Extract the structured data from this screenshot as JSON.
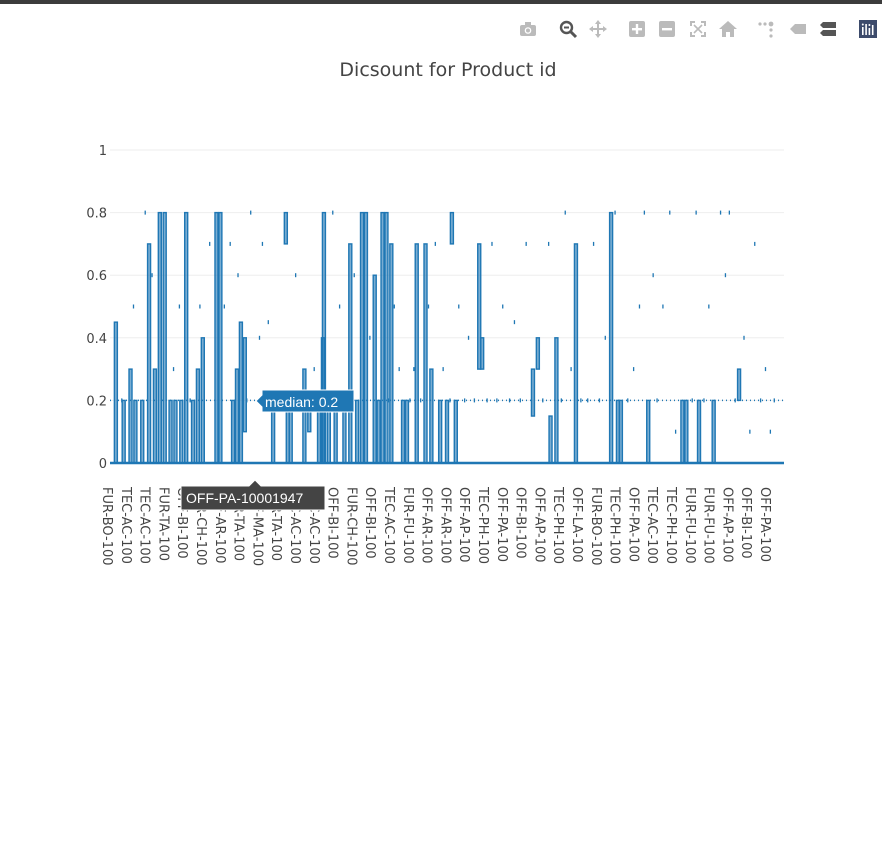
{
  "modebar": {
    "buttons": [
      {
        "name": "camera-icon",
        "title": "Download plot as a png"
      },
      {
        "name": "zoom-icon",
        "title": "Zoom"
      },
      {
        "name": "pan-icon",
        "title": "Pan"
      },
      {
        "name": "zoom-in-icon",
        "title": "Zoom in"
      },
      {
        "name": "zoom-out-icon",
        "title": "Zoom out"
      },
      {
        "name": "autoscale-icon",
        "title": "Autoscale"
      },
      {
        "name": "reset-axes-icon",
        "title": "Reset axes"
      },
      {
        "name": "spike-lines-icon",
        "title": "Toggle Spike Lines"
      },
      {
        "name": "hover-closest-icon",
        "title": "Show closest data on hover"
      },
      {
        "name": "hover-compare-icon",
        "title": "Compare data on hover"
      },
      {
        "name": "plotly-logo-icon",
        "title": "Produced with Plotly"
      }
    ]
  },
  "chart_data": {
    "type": "box",
    "title": "Dicsount for Product id",
    "xlabel": "",
    "ylabel": "",
    "ylim": [
      0,
      1
    ],
    "yticks": [
      0,
      0.2,
      0.4,
      0.6,
      0.8,
      1
    ],
    "ytick_labels": [
      "0",
      "0.2",
      "0.4",
      "0.6",
      "0.8",
      "1"
    ],
    "xtick_labels": [
      "FUR-BO-100",
      "TEC-AC-100",
      "TEC-AC-100",
      "FUR-TA-100",
      "OFF-BI-100",
      "FUR-CH-100",
      "OFF-AR-100",
      "FUR-TA-100",
      "OFF-MA-100",
      "FUR-TA-100",
      "TEC-AC-100",
      "TEC-AC-100",
      "OFF-BI-100",
      "FUR-CH-100",
      "OFF-BI-100",
      "TEC-AC-100",
      "FUR-FU-100",
      "OFF-AR-100",
      "OFF-AR-100",
      "OFF-AP-100",
      "TEC-PH-100",
      "OFF-PA-100",
      "OFF-BI-100",
      "OFF-AP-100",
      "TEC-PH-100",
      "OFF-LA-100",
      "FUR-BO-100",
      "TEC-PH-100",
      "OFF-PA-100",
      "TEC-AC-100",
      "TEC-PH-100",
      "FUR-FU-100",
      "FUR-FU-100",
      "OFF-AP-100",
      "OFF-BI-100",
      "OFF-PA-100"
    ],
    "series_color": "#1f77b4",
    "grid": true,
    "boxes": [
      {
        "x": 0.6,
        "lo": 0,
        "hi": 0.45
      },
      {
        "x": 1.4,
        "lo": 0,
        "hi": 0.2
      },
      {
        "x": 2.1,
        "lo": 0,
        "hi": 0.3
      },
      {
        "x": 2.6,
        "lo": 0,
        "hi": 0.2
      },
      {
        "x": 3.3,
        "lo": 0,
        "hi": 0.2
      },
      {
        "x": 4.0,
        "lo": 0,
        "hi": 0.7
      },
      {
        "x": 4.6,
        "lo": 0,
        "hi": 0.3
      },
      {
        "x": 5.1,
        "lo": 0,
        "hi": 0.8
      },
      {
        "x": 5.6,
        "lo": 0,
        "hi": 0.8
      },
      {
        "x": 6.2,
        "lo": 0,
        "hi": 0.2
      },
      {
        "x": 6.7,
        "lo": 0,
        "hi": 0.2
      },
      {
        "x": 7.3,
        "lo": 0,
        "hi": 0.2
      },
      {
        "x": 7.8,
        "lo": 0,
        "hi": 0.8
      },
      {
        "x": 8.5,
        "lo": 0,
        "hi": 0.2
      },
      {
        "x": 9.0,
        "lo": 0,
        "hi": 0.3
      },
      {
        "x": 9.5,
        "lo": 0,
        "hi": 0.4
      },
      {
        "x": 10.9,
        "lo": 0,
        "hi": 0.8
      },
      {
        "x": 11.3,
        "lo": 0,
        "hi": 0.8
      },
      {
        "x": 12.6,
        "lo": 0,
        "hi": 0.2
      },
      {
        "x": 13.0,
        "lo": 0,
        "hi": 0.3
      },
      {
        "x": 13.4,
        "lo": 0,
        "hi": 0.45
      },
      {
        "x": 13.8,
        "lo": 0.1,
        "hi": 0.4
      },
      {
        "x": 16.7,
        "lo": 0,
        "hi": 0.2
      },
      {
        "x": 18.0,
        "lo": 0.7,
        "hi": 0.8
      },
      {
        "x": 18.2,
        "lo": 0,
        "hi": 0.2
      },
      {
        "x": 18.5,
        "lo": 0,
        "hi": 0.2
      },
      {
        "x": 19.9,
        "lo": 0,
        "hi": 0.3
      },
      {
        "x": 20.4,
        "lo": 0.1,
        "hi": 0.2
      },
      {
        "x": 21.4,
        "lo": 0,
        "hi": 0.2
      },
      {
        "x": 21.8,
        "lo": 0,
        "hi": 0.4
      },
      {
        "x": 21.9,
        "lo": 0,
        "hi": 0.8
      },
      {
        "x": 22.4,
        "lo": 0,
        "hi": 0.2
      },
      {
        "x": 23.1,
        "lo": 0,
        "hi": 0.2
      },
      {
        "x": 24.0,
        "lo": 0,
        "hi": 0.2
      },
      {
        "x": 24.6,
        "lo": 0,
        "hi": 0.7
      },
      {
        "x": 25.3,
        "lo": 0,
        "hi": 0.2
      },
      {
        "x": 25.8,
        "lo": 0,
        "hi": 0.8
      },
      {
        "x": 26.2,
        "lo": 0,
        "hi": 0.8
      },
      {
        "x": 27.1,
        "lo": 0,
        "hi": 0.6
      },
      {
        "x": 27.5,
        "lo": 0,
        "hi": 0.2
      },
      {
        "x": 27.9,
        "lo": 0,
        "hi": 0.8
      },
      {
        "x": 28.3,
        "lo": 0,
        "hi": 0.8
      },
      {
        "x": 28.8,
        "lo": 0,
        "hi": 0.7
      },
      {
        "x": 30.0,
        "lo": 0,
        "hi": 0.2
      },
      {
        "x": 30.4,
        "lo": 0,
        "hi": 0.2
      },
      {
        "x": 31.4,
        "lo": 0,
        "hi": 0.7
      },
      {
        "x": 32.3,
        "lo": 0,
        "hi": 0.7
      },
      {
        "x": 32.9,
        "lo": 0,
        "hi": 0.3
      },
      {
        "x": 33.8,
        "lo": 0,
        "hi": 0.2
      },
      {
        "x": 34.5,
        "lo": 0,
        "hi": 0.2
      },
      {
        "x": 35.0,
        "lo": 0.7,
        "hi": 0.8
      },
      {
        "x": 35.4,
        "lo": 0,
        "hi": 0.2
      },
      {
        "x": 37.8,
        "lo": 0.3,
        "hi": 0.7
      },
      {
        "x": 38.1,
        "lo": 0.3,
        "hi": 0.4
      },
      {
        "x": 43.3,
        "lo": 0.15,
        "hi": 0.3
      },
      {
        "x": 43.8,
        "lo": 0.3,
        "hi": 0.4
      },
      {
        "x": 45.1,
        "lo": 0,
        "hi": 0.15
      },
      {
        "x": 45.7,
        "lo": 0,
        "hi": 0.4
      },
      {
        "x": 47.7,
        "lo": 0,
        "hi": 0.7
      },
      {
        "x": 51.3,
        "lo": 0,
        "hi": 0.8
      },
      {
        "x": 52.0,
        "lo": 0,
        "hi": 0.2
      },
      {
        "x": 52.3,
        "lo": 0,
        "hi": 0.2
      },
      {
        "x": 55.1,
        "lo": 0,
        "hi": 0.2
      },
      {
        "x": 58.6,
        "lo": 0,
        "hi": 0.2
      },
      {
        "x": 59.0,
        "lo": 0,
        "hi": 0.2
      },
      {
        "x": 60.3,
        "lo": 0,
        "hi": 0.2
      },
      {
        "x": 61.8,
        "lo": 0,
        "hi": 0.2
      },
      {
        "x": 64.4,
        "lo": 0.2,
        "hi": 0.3
      }
    ],
    "outliers": [
      {
        "x": 1.2,
        "y": 0.2
      },
      {
        "x": 2.4,
        "y": 0.5
      },
      {
        "x": 3.6,
        "y": 0.8
      },
      {
        "x": 4.3,
        "y": 0.6
      },
      {
        "x": 6.5,
        "y": 0.3
      },
      {
        "x": 7.1,
        "y": 0.5
      },
      {
        "x": 8.2,
        "y": 0.2
      },
      {
        "x": 9.2,
        "y": 0.5
      },
      {
        "x": 10.2,
        "y": 0.7
      },
      {
        "x": 11.7,
        "y": 0.5
      },
      {
        "x": 12.3,
        "y": 0.7
      },
      {
        "x": 13.1,
        "y": 0.6
      },
      {
        "x": 14.0,
        "y": 0.2
      },
      {
        "x": 14.4,
        "y": 0.8
      },
      {
        "x": 15.3,
        "y": 0.4
      },
      {
        "x": 15.6,
        "y": 0.7
      },
      {
        "x": 16.2,
        "y": 0.45
      },
      {
        "x": 16.9,
        "y": 0.2
      },
      {
        "x": 17.6,
        "y": 0.2
      },
      {
        "x": 19.0,
        "y": 0.6
      },
      {
        "x": 19.5,
        "y": 0.2
      },
      {
        "x": 20.9,
        "y": 0.3
      },
      {
        "x": 22.8,
        "y": 0.8
      },
      {
        "x": 23.5,
        "y": 0.5
      },
      {
        "x": 24.3,
        "y": 0.2
      },
      {
        "x": 25.0,
        "y": 0.6
      },
      {
        "x": 26.6,
        "y": 0.4
      },
      {
        "x": 28.5,
        "y": 0.2
      },
      {
        "x": 29.1,
        "y": 0.5
      },
      {
        "x": 29.6,
        "y": 0.3
      },
      {
        "x": 30.7,
        "y": 0.2
      },
      {
        "x": 31.1,
        "y": 0.3
      },
      {
        "x": 31.8,
        "y": 0.2
      },
      {
        "x": 32.6,
        "y": 0.5
      },
      {
        "x": 33.3,
        "y": 0.7
      },
      {
        "x": 34.1,
        "y": 0.3
      },
      {
        "x": 34.8,
        "y": 0.2
      },
      {
        "x": 35.7,
        "y": 0.5
      },
      {
        "x": 36.3,
        "y": 0.2
      },
      {
        "x": 36.7,
        "y": 0.4
      },
      {
        "x": 37.3,
        "y": 0.2
      },
      {
        "x": 38.6,
        "y": 0.2
      },
      {
        "x": 39.1,
        "y": 0.7
      },
      {
        "x": 39.6,
        "y": 0.2
      },
      {
        "x": 40.2,
        "y": 0.5
      },
      {
        "x": 40.9,
        "y": 0.2
      },
      {
        "x": 41.4,
        "y": 0.45
      },
      {
        "x": 42.0,
        "y": 0.2
      },
      {
        "x": 42.6,
        "y": 0.7
      },
      {
        "x": 44.3,
        "y": 0.2
      },
      {
        "x": 44.9,
        "y": 0.7
      },
      {
        "x": 46.2,
        "y": 0.2
      },
      {
        "x": 46.6,
        "y": 0.8
      },
      {
        "x": 47.2,
        "y": 0.3
      },
      {
        "x": 48.2,
        "y": 0.2
      },
      {
        "x": 48.9,
        "y": 0.2
      },
      {
        "x": 49.5,
        "y": 0.7
      },
      {
        "x": 50.1,
        "y": 0.2
      },
      {
        "x": 50.7,
        "y": 0.4
      },
      {
        "x": 51.7,
        "y": 0.8
      },
      {
        "x": 53.0,
        "y": 0.2
      },
      {
        "x": 53.6,
        "y": 0.3
      },
      {
        "x": 54.2,
        "y": 0.5
      },
      {
        "x": 54.7,
        "y": 0.8
      },
      {
        "x": 55.6,
        "y": 0.6
      },
      {
        "x": 56.0,
        "y": 0.2
      },
      {
        "x": 56.6,
        "y": 0.5
      },
      {
        "x": 57.3,
        "y": 0.8
      },
      {
        "x": 57.9,
        "y": 0.1
      },
      {
        "x": 59.6,
        "y": 0.2
      },
      {
        "x": 60.0,
        "y": 0.8
      },
      {
        "x": 60.8,
        "y": 0.2
      },
      {
        "x": 61.3,
        "y": 0.5
      },
      {
        "x": 62.5,
        "y": 0.8
      },
      {
        "x": 63.0,
        "y": 0.6
      },
      {
        "x": 63.4,
        "y": 0.8
      },
      {
        "x": 64.0,
        "y": 0.2
      },
      {
        "x": 64.9,
        "y": 0.4
      },
      {
        "x": 65.5,
        "y": 0.1
      },
      {
        "x": 66.0,
        "y": 0.7
      },
      {
        "x": 66.6,
        "y": 0.2
      },
      {
        "x": 67.1,
        "y": 0.3
      },
      {
        "x": 67.6,
        "y": 0.1
      },
      {
        "x": 68.0,
        "y": 0.2
      }
    ],
    "x_range": [
      0,
      69
    ],
    "hover": {
      "label": "median: 0.2",
      "x_label": "OFF-PA-10001947",
      "x": 15.3,
      "y": 0.2
    }
  }
}
